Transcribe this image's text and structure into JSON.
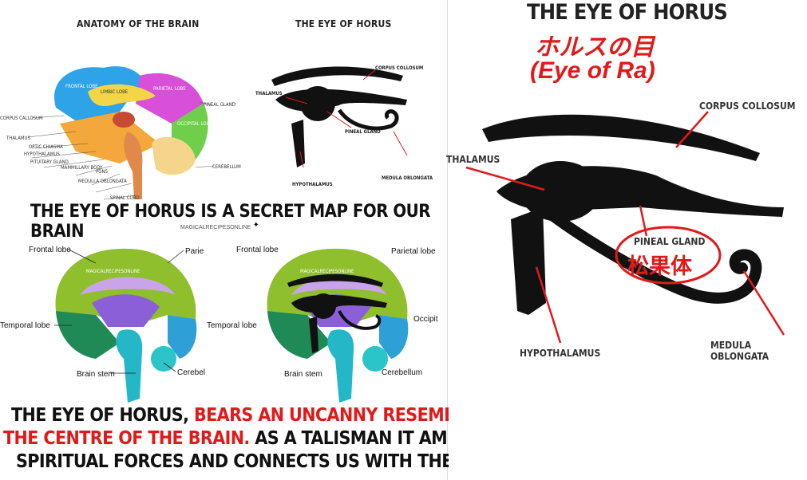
{
  "left_panel": {
    "anatomy_title": "ANATOMY OF THE BRAIN",
    "eye_title": "THE EYE OF HORUS",
    "anatomy_labels": {
      "frontal_lobe": "FRONTAL LOBE",
      "limbic_lobe": "LIMBIC LOBE",
      "parietal_lobe": "PARIETAL LOBE",
      "occipital_lobe": "OCCIPITAL LOBE",
      "corpus_callosum": "CORPUS CALLOSUM",
      "thalamus": "THALAMUS",
      "optic_chiasma": "OPTIC CHIASMA",
      "hypothalamus": "HYPOTHALAMUS",
      "pituitary_gland": "PITUITARY GLAND",
      "mammillary_body": "MAMMILLARY BODY",
      "pons": "PONS",
      "medulla_oblongata": "MEDULLA OBLONGATA",
      "spinal_cord": "SPINAL CORD",
      "pineal_gland": "PINEAL GLAND",
      "cerebellum": "CEREBELLUM"
    },
    "eye_labels": {
      "corpus_collosum": "CORPUS COLLOSUM",
      "thalamus": "THALAMUS",
      "pineal_gland": "PINEAL GLAND",
      "hypothalamus": "HYPOTHALAMUS",
      "medula_oblongata": "MEDULA OBLONGATA"
    },
    "headline": "THE EYE OF HORUS IS A SECRET MAP FOR OUR BRAIN",
    "watermark": "MAGICALRECIPESONLINE",
    "brain1_labels": {
      "frontal": "Frontal lobe",
      "parietal": "Parie",
      "temporal": "Temporal lobe",
      "stem": "Brain stem",
      "cerebellum": "Cerebel"
    },
    "brain2_labels": {
      "frontal": "Frontal lobe",
      "parietal": "Parietal lobe",
      "temporal": "Temporal lobe",
      "occipital": "Occipit",
      "stem": "Brain stem",
      "cerebellum": "Cerebellum"
    },
    "caption": {
      "part1": "THE EYE OF HORUS, ",
      "part2_red": "BEARS AN UNCANNY RESEMBLANCE TO",
      "part3_red": "THE CENTRE OF THE BRAIN.",
      "part4": " AS A TALISMAN IT AMPLIFIES OUR",
      "line3": "SPIRITUAL FORCES AND CONNECTS US WITH THE DIVINE."
    }
  },
  "right_panel": {
    "title": "THE EYE OF HORUS",
    "japanese_title": "ホルスの目",
    "subtitle": "(Eye of Ra)",
    "labels": {
      "corpus_collosum": "CORPUS COLLOSUM",
      "thalamus": "THALAMUS",
      "pineal_gland": "PINEAL GLAND",
      "pineal_japanese": "松果体",
      "hypothalamus": "HYPOTHALAMUS",
      "medula_oblongata": "MEDULA OBLONGATA"
    }
  },
  "colors": {
    "accent_red": "#e01a1a",
    "text_dark": "#111111"
  }
}
